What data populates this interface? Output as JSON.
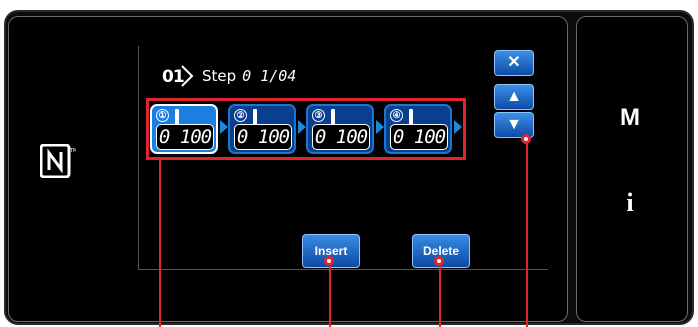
{
  "screen": {
    "title": {
      "step_number": "01",
      "label": "Step",
      "count": "0 1/04"
    },
    "steps": [
      {
        "index": "①",
        "value": "0 100",
        "selected": true
      },
      {
        "index": "②",
        "value": "0 100",
        "selected": false
      },
      {
        "index": "③",
        "value": "0 100",
        "selected": false
      },
      {
        "index": "④",
        "value": "0 100",
        "selected": false
      }
    ],
    "controls": {
      "close_glyph": "✕",
      "up_glyph": "▲",
      "down_glyph": "▼"
    },
    "actions": {
      "insert_label": "Insert",
      "delete_label": "Delete"
    },
    "side_panel": {
      "mode_label": "M",
      "info_label": "i"
    }
  },
  "colors": {
    "accent_blue": "#1a7fe0",
    "callout_red": "#e0252f",
    "screen_bg": "#000000"
  },
  "icons": [
    "nfc-icon",
    "step-badge-icon",
    "needle-icon",
    "close-icon",
    "up-arrow-icon",
    "down-arrow-icon"
  ]
}
